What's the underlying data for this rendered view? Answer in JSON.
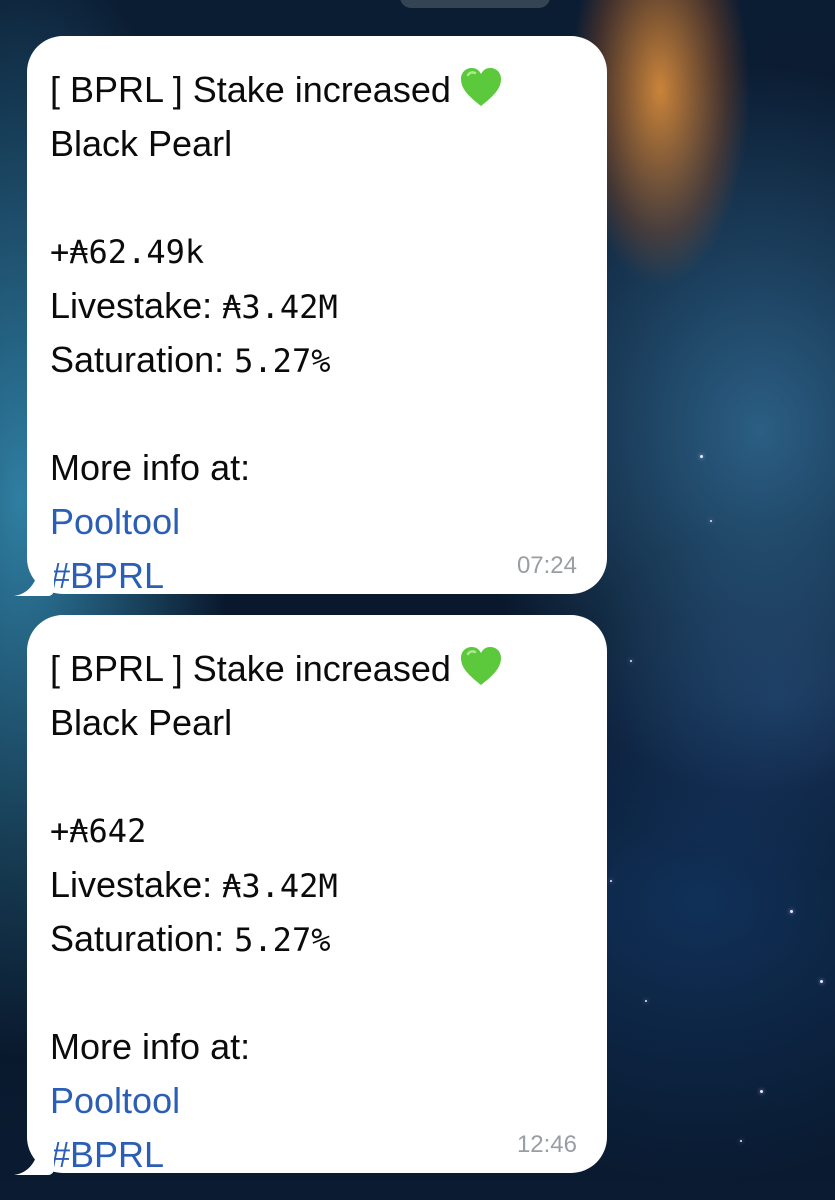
{
  "messages": [
    {
      "title": "[ BPRL ] Stake increased",
      "pool_name": "Black Pearl",
      "amount": "+₳62.49k",
      "livestake_label": "Livestake:",
      "livestake_value": "₳3.42M",
      "saturation_label": "Saturation:",
      "saturation_value": "5.27%",
      "more_info": "More info at:",
      "link": "Pooltool",
      "hashtag": "#BPRL",
      "time": "07:24"
    },
    {
      "title": "[ BPRL ] Stake increased",
      "pool_name": "Black Pearl",
      "amount": "+₳642",
      "livestake_label": "Livestake:",
      "livestake_value": "₳3.42M",
      "saturation_label": "Saturation:",
      "saturation_value": "5.27%",
      "more_info": "More info at:",
      "link": "Pooltool",
      "hashtag": "#BPRL",
      "time": "12:46"
    }
  ],
  "colors": {
    "bubble": "#ffffff",
    "link": "#2b5fb5",
    "time": "#9a9ea3",
    "heart": "#5cc83c"
  },
  "icons": {
    "status_emoji": "green-heart-icon"
  }
}
